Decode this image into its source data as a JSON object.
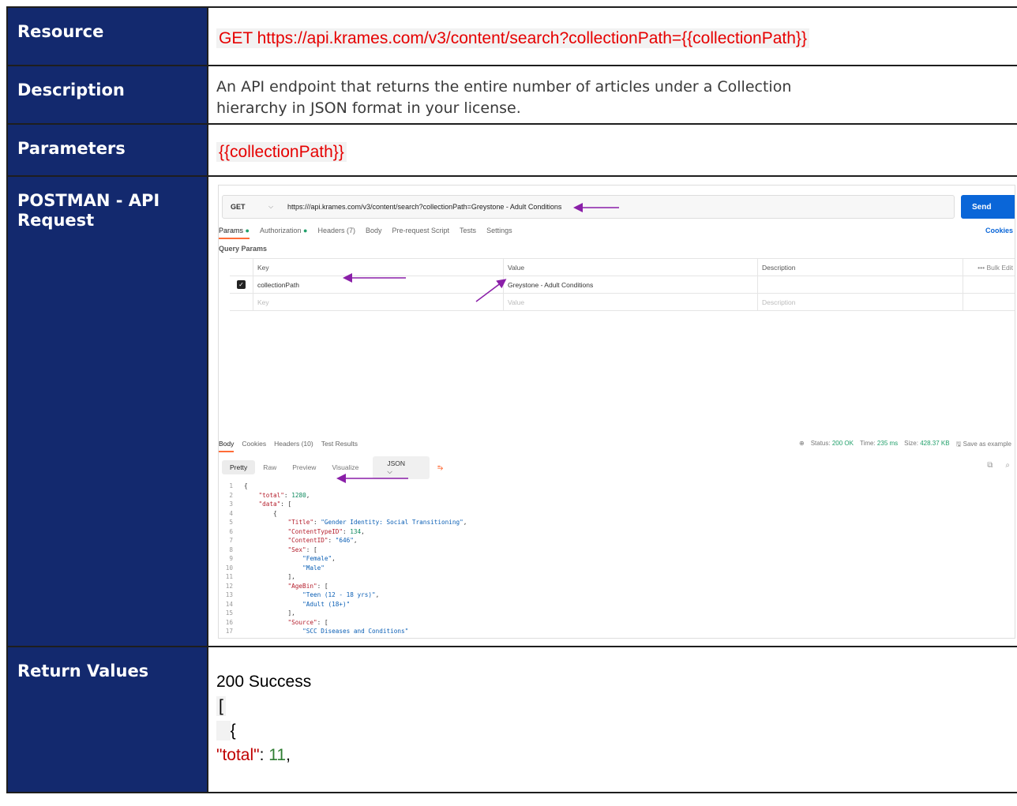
{
  "rows": {
    "resource": {
      "label": "Resource",
      "value": "GET https://api.krames.com/v3/content/search?collectionPath={{collectionPath}}"
    },
    "description": {
      "label": "Description",
      "line1": "An API endpoint that returns the entire number of articles under a Collection",
      "line2": "hierarchy in JSON format in your license."
    },
    "parameters": {
      "label": "Parameters",
      "value": "{{collectionPath}}"
    },
    "postman": {
      "label": "POSTMAN - API Request"
    },
    "return_values": {
      "label": "Return Values",
      "line1": "200 Success",
      "line2": "[",
      "line3": "{",
      "key": "\"total\"",
      "colon": ": ",
      "value": "11",
      "comma": ","
    }
  },
  "postman": {
    "method": "GET",
    "url": "https:///api.krames.com/v3/content/search?collectionPath=Greystone - Adult Conditions",
    "send": "Send",
    "tabs": {
      "params": "Params",
      "authorization": "Authorization",
      "headers": "Headers (7)",
      "body": "Body",
      "prerequest": "Pre-request Script",
      "tests": "Tests",
      "settings": "Settings"
    },
    "cookies_link": "Cookies",
    "query_params_title": "Query Params",
    "table": {
      "col_key": "Key",
      "col_value": "Value",
      "col_description": "Description",
      "bulk_edit": "Bulk Edit",
      "row_key": "collectionPath",
      "row_value": "Greystone - Adult Conditions",
      "ph_key": "Key",
      "ph_value": "Value",
      "ph_description": "Description"
    },
    "response_tabs": {
      "body": "Body",
      "cookies": "Cookies",
      "headers": "Headers (10)",
      "test_results": "Test Results"
    },
    "status": {
      "status_label": "Status:",
      "status_value": "200 OK",
      "time_label": "Time:",
      "time_value": "235 ms",
      "size_label": "Size:",
      "size_value": "428.37 KB",
      "save": "Save as example"
    },
    "view": {
      "pretty": "Pretty",
      "raw": "Raw",
      "preview": "Preview",
      "visualize": "Visualize",
      "format": "JSON"
    },
    "code": {
      "l1": "{",
      "l2k": "\"total\"",
      "l2v": "1280",
      "l3k": "\"data\"",
      "l4": "{",
      "l5k": "\"Title\"",
      "l5v": "\"Gender Identity: Social Transitioning\"",
      "l6k": "\"ContentTypeID\"",
      "l6v": "134",
      "l7k": "\"ContentID\"",
      "l7v": "\"646\"",
      "l8k": "\"Sex\"",
      "l9v": "\"Female\"",
      "l10v": "\"Male\"",
      "l12k": "\"AgeBin\"",
      "l13v": "\"Teen (12 - 18 yrs)\"",
      "l14v": "\"Adult (18+)\"",
      "l16k": "\"Source\"",
      "l17v": "\"SCC Diseases and Conditions\""
    }
  },
  "colors": {
    "label_bg": "#13296e",
    "accent_red": "#e60000",
    "annotation_arrow": "#8a1fa8",
    "send_button": "#0a66d8"
  }
}
